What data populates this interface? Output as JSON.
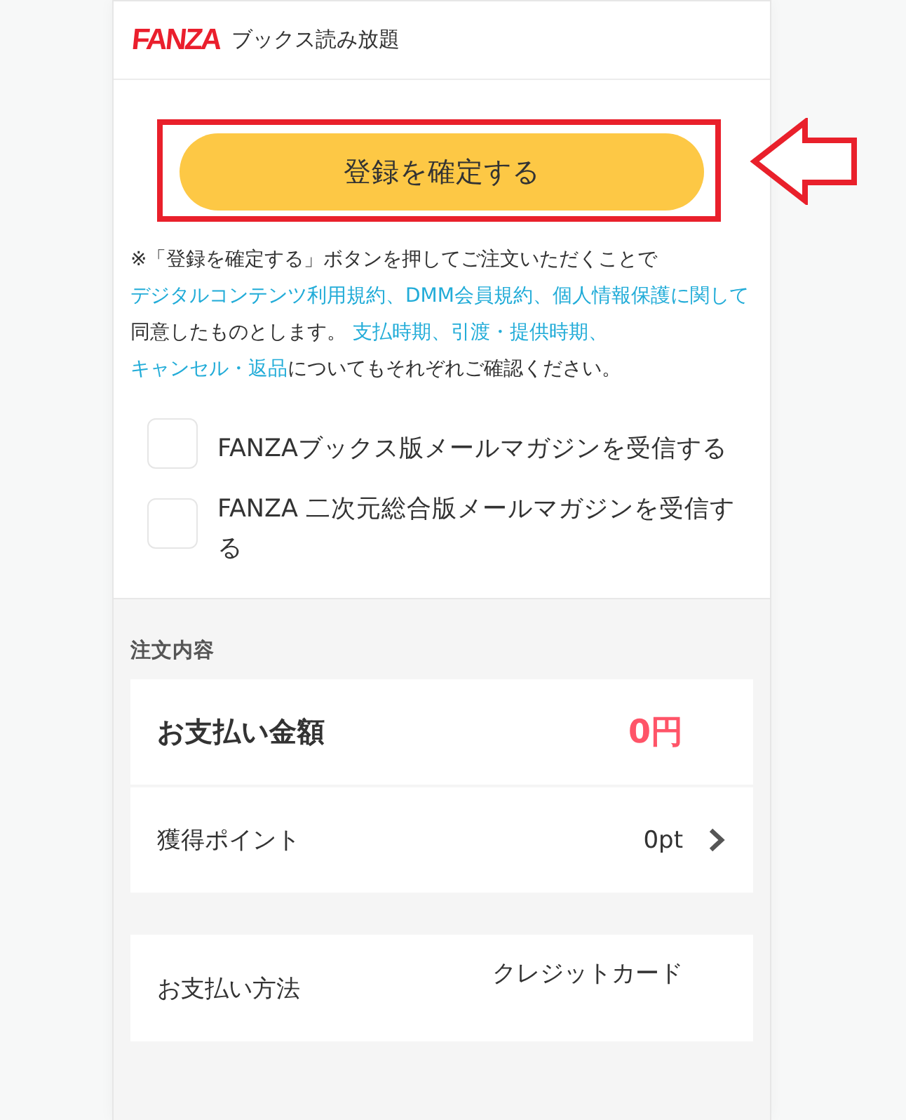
{
  "header": {
    "logo": "FANZA",
    "title": "ブックス読み放題"
  },
  "confirm_button": {
    "label": "登録を確定する",
    "highlighted": true
  },
  "notice": [
    {
      "kind": "text",
      "text": "※「登録を確定する」ボタンを押してご注文いただくことで "
    },
    {
      "kind": "link",
      "text": "デジタルコンテンツ利用規約、"
    },
    {
      "kind": "link",
      "text": "DMM会員規約、"
    },
    {
      "kind": "link",
      "text": "個人情報保護に関して"
    },
    {
      "kind": "text",
      "text": "同意したものとします。 "
    },
    {
      "kind": "link",
      "text": "支払時期、"
    },
    {
      "kind": "link",
      "text": "引渡・提供時期、"
    },
    {
      "kind": "link",
      "text": "キャンセル・返品"
    },
    {
      "kind": "text",
      "text": "についてもそれぞれご確認ください。"
    }
  ],
  "newsletters": [
    {
      "label": "FANZAブックス版メールマガジンを受信する",
      "checked": false
    },
    {
      "label": "FANZA 二次元総合版メールマガジンを受信する",
      "checked": false
    }
  ],
  "order": {
    "heading": "注文内容",
    "summary": [
      {
        "kind": "total",
        "label": "お支払い金額",
        "value": "0円"
      },
      {
        "kind": "link",
        "label": "獲得ポイント",
        "value": "0pt"
      }
    ],
    "payment": {
      "label": "お支払い方法",
      "value": "クレジットカード"
    }
  }
}
